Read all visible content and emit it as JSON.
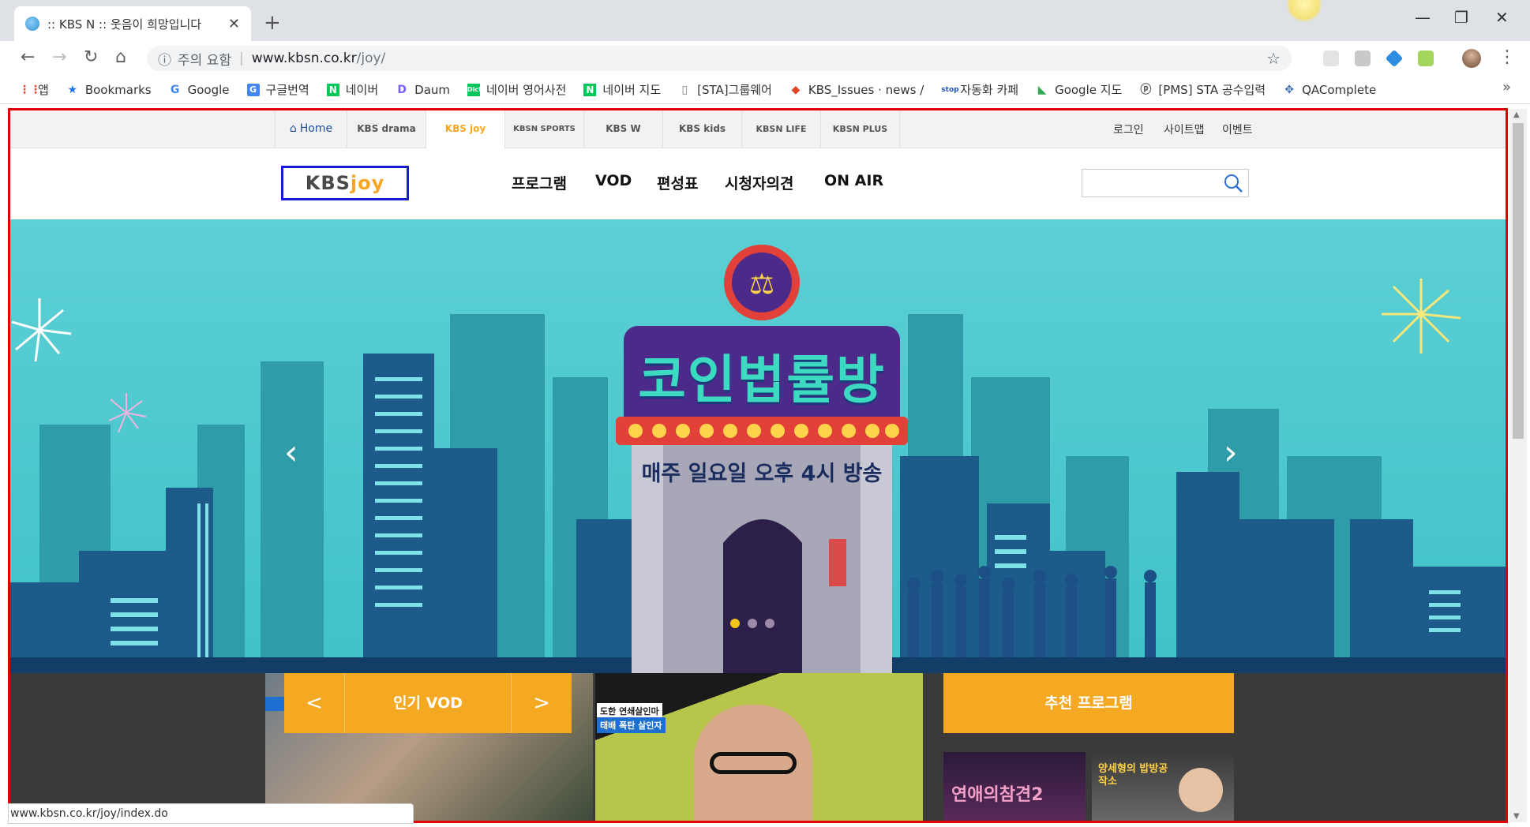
{
  "browser": {
    "tab_title": ":: KBS N :: 웃음이 희망입니다",
    "tab_close": "✕",
    "new_tab": "+",
    "security_label": "주의 요함",
    "url_host": "www.kbsn.co.kr",
    "url_path": "/joy/",
    "status_url": "www.kbsn.co.kr/joy/index.do",
    "bookmarks_more": "»"
  },
  "bookmarks": [
    {
      "label": "앱",
      "icon": "apps-icon",
      "color": "#e94235"
    },
    {
      "label": "Bookmarks",
      "icon": "star-icon",
      "color": "#1a73e8"
    },
    {
      "label": "Google",
      "icon": "google-icon",
      "color": "#4285f4"
    },
    {
      "label": "구글번역",
      "icon": "translate-icon",
      "color": "#4285f4"
    },
    {
      "label": "네이버",
      "icon": "naver-icon",
      "color": "#03c75a"
    },
    {
      "label": "Daum",
      "icon": "daum-icon",
      "color": "#7b61ff"
    },
    {
      "label": "네이버 영어사전",
      "icon": "dict-icon",
      "color": "#03c75a"
    },
    {
      "label": "네이버 지도",
      "icon": "naver-map-icon",
      "color": "#03c75a"
    },
    {
      "label": "[STA]그룹웨어",
      "icon": "page-icon",
      "color": "#888888"
    },
    {
      "label": "KBS_Issues · news /",
      "icon": "gitlab-icon",
      "color": "#e24329"
    },
    {
      "label": "자동화 카페",
      "icon": "stop-icon",
      "color": "#2255cc"
    },
    {
      "label": "Google 지도",
      "icon": "google-maps-icon",
      "color": "#34a853"
    },
    {
      "label": "[PMS] STA 공수입력",
      "icon": "pms-icon",
      "color": "#555555"
    },
    {
      "label": "QAComplete",
      "icon": "qacomplete-icon",
      "color": "#3a6fb0"
    }
  ],
  "gnb": {
    "items": [
      {
        "label": "Home",
        "icon": "home-icon"
      },
      {
        "label": "KBS drama"
      },
      {
        "label": "KBS joy"
      },
      {
        "label": "KBSN SPORTS"
      },
      {
        "label": "KBS W"
      },
      {
        "label": "KBS kids"
      },
      {
        "label": "KBSN LIFE"
      },
      {
        "label": "KBSN PLUS"
      }
    ],
    "util": [
      "로그인",
      "사이트맵",
      "이벤트"
    ]
  },
  "header": {
    "logo_kbs": "KBS",
    "logo_joy": "joy",
    "menu": [
      "프로그램",
      "VOD",
      "편성표",
      "시청자의견",
      "ON AIR"
    ],
    "search_placeholder": ""
  },
  "hero": {
    "title": "코인법률방",
    "subtitle": "매주 일요일 오후 4시 방송",
    "prev": "‹",
    "next": "›",
    "slide_count": 3,
    "active_slide": 1
  },
  "bottom": {
    "vod_title": "인기 VOD",
    "vod_prev": "<",
    "vod_next": ">",
    "recommend_title": "추천 프로그램",
    "thumb2_caption_1": "도한 연쇄살인마",
    "thumb2_caption_2": "태배 폭탄 살인자",
    "rec1_title": "연애의참견2",
    "rec2_title": "양세형의 밥방공작소"
  },
  "colors": {
    "accent": "#f5a922",
    "sky": "#4fcad0",
    "highlight_frame": "#e00000",
    "logo_frame": "#1b1bd6"
  }
}
